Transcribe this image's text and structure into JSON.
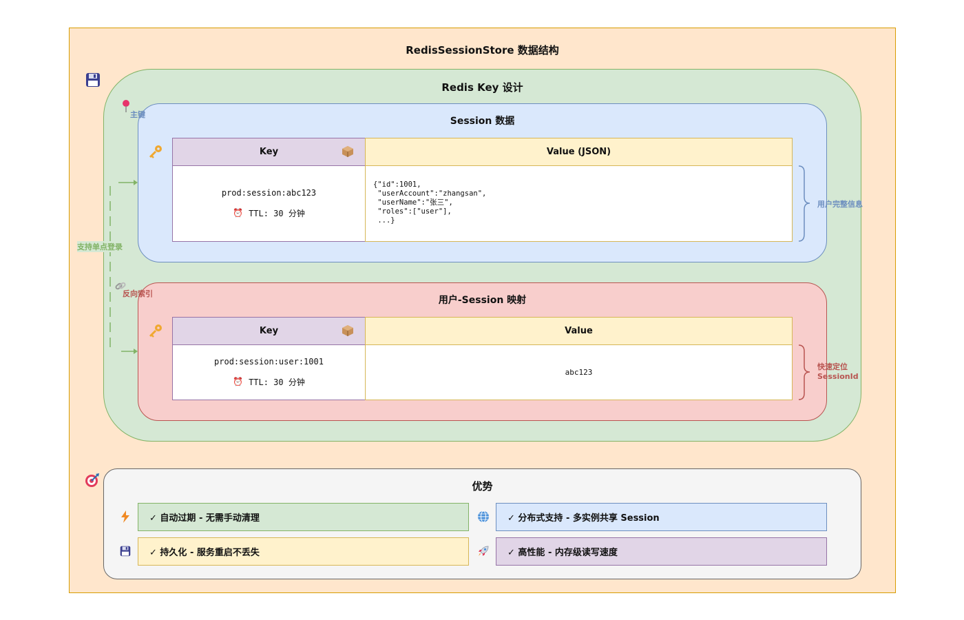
{
  "colors": {
    "outer_fill": "#ffe6cc",
    "outer_stroke": "#d79b00",
    "green_fill": "#d5e8d4",
    "green_stroke": "#82b366",
    "blue_fill": "#dae8fc",
    "blue_stroke": "#6c8ebf",
    "red_fill": "#f8cecc",
    "red_stroke": "#b85450",
    "purple_fill": "#e1d5e7",
    "purple_stroke": "#9673a6",
    "yellow_fill": "#fff2cc",
    "yellow_stroke": "#d6b656",
    "gray_fill": "#f5f5f5",
    "gray_stroke": "#666666"
  },
  "diagram": {
    "title": "RedisSessionStore 数据结构",
    "key_design": {
      "title": "Redis Key 设计",
      "icon": "floppy-disk-icon"
    },
    "session": {
      "title": "Session 数据",
      "key_header": "Key",
      "value_header": "Value (JSON)",
      "key_value": "prod:session:abc123",
      "ttl": "TTL: 30 分钟",
      "json_value": "{\"id\":1001,\n \"userAccount\":\"zhangsan\",\n \"userName\":\"张三\",\n \"roles\":[\"user\"],\n ...}",
      "brace_note": "用户完整信息",
      "primary_label": "主键"
    },
    "mapping": {
      "title": "用户-Session 映射",
      "key_header": "Key",
      "value_header": "Value",
      "key_value": "prod:session:user:1001",
      "ttl": "TTL: 30 分钟",
      "value": "abc123",
      "brace_note_line1": "快速定位",
      "brace_note_line2": "SessionId",
      "reverse_label": "反向索引"
    },
    "sso_label": "支持单点登录",
    "advantages": {
      "title": "优势",
      "items": [
        {
          "label": "✓ 自动过期 - 无需手动清理",
          "icon": "lightning-icon"
        },
        {
          "label": "✓ 分布式支持 - 多实例共享 Session",
          "icon": "globe-icon"
        },
        {
          "label": "✓ 持久化 - 服务重启不丢失",
          "icon": "floppy-disk-icon"
        },
        {
          "label": "✓ 高性能 - 内存级读写速度",
          "icon": "rocket-icon"
        }
      ]
    }
  }
}
